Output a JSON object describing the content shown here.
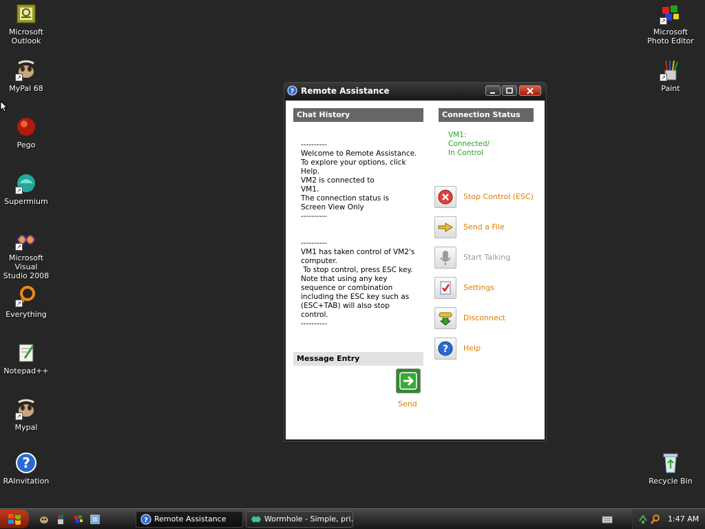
{
  "desktop": {
    "icons_left": [
      {
        "label": "Microsoft\nOutlook",
        "icon": "outlook-icon"
      },
      {
        "label": "MyPal 68",
        "icon": "mypal-icon"
      },
      {
        "label": "Pego",
        "icon": "pego-icon"
      },
      {
        "label": "Supermium",
        "icon": "supermium-icon"
      },
      {
        "label": "Microsoft Visual\nStudio 2008",
        "icon": "visual-studio-icon"
      },
      {
        "label": "Everything",
        "icon": "everything-icon"
      },
      {
        "label": "Notepad++",
        "icon": "notepadpp-icon"
      },
      {
        "label": "Mypal",
        "icon": "mypal-icon"
      },
      {
        "label": "RAInvitation",
        "icon": "help-icon"
      }
    ],
    "icons_right": [
      {
        "label": "Microsoft\nPhoto Editor",
        "icon": "photo-editor-icon"
      },
      {
        "label": "Paint",
        "icon": "paint-icon"
      },
      {
        "label": "Recycle Bin",
        "icon": "recycle-bin-icon"
      }
    ]
  },
  "window": {
    "title": "Remote Assistance",
    "chat_history": {
      "header": "Chat History",
      "text": "----------\nWelcome to Remote Assistance.\nTo explore your options, click\nHelp.\nVM2 is connected to\nVM1.\nThe connection status is\nScreen View Only\n----------\n\n\n----------\nVM1 has taken control of VM2's\ncomputer.\n To stop control, press ESC key.\nNote that using any key\nsequence or combination\nincluding the ESC key such as\n(ESC+TAB) will also stop control.\n----------"
    },
    "connection_status": {
      "header": "Connection Status",
      "text": "VM1:\nConnected/\nIn Control"
    },
    "actions": [
      {
        "label": "Stop Control (ESC)",
        "icon": "stop-icon",
        "enabled": true
      },
      {
        "label": "Send a File",
        "icon": "send-file-icon",
        "enabled": true
      },
      {
        "label": "Start Talking",
        "icon": "microphone-icon",
        "enabled": false
      },
      {
        "label": "Settings",
        "icon": "settings-icon",
        "enabled": true
      },
      {
        "label": "Disconnect",
        "icon": "disconnect-icon",
        "enabled": true
      },
      {
        "label": "Help",
        "icon": "help-icon",
        "enabled": true
      }
    ],
    "message_entry": {
      "header": "Message Entry",
      "value": "",
      "send_label": "Send"
    }
  },
  "taskbar": {
    "tasks": [
      {
        "label": "Remote Assistance",
        "icon": "help-icon",
        "active": true
      },
      {
        "label": "Wormhole - Simple, pri...",
        "icon": "wormhole-icon",
        "active": false
      }
    ],
    "clock": "1:47 AM"
  },
  "colors": {
    "desktop": "#262626",
    "accent_orange": "#e07b00",
    "status_green": "#2aa02a",
    "header_gray": "#666666"
  }
}
